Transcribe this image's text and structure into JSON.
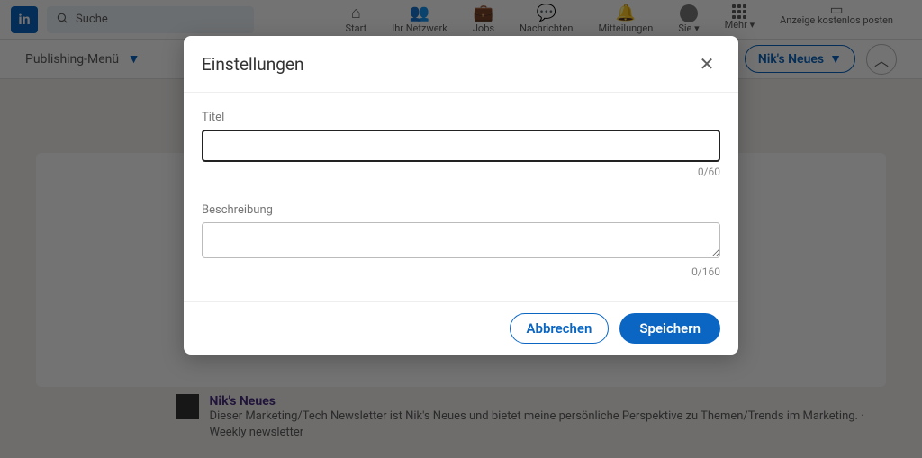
{
  "topnav": {
    "search_placeholder": "Suche",
    "items": [
      {
        "label": "Start"
      },
      {
        "label": "Ihr Netzwerk"
      },
      {
        "label": "Jobs"
      },
      {
        "label": "Nachrichten"
      },
      {
        "label": "Mitteilungen"
      },
      {
        "label": "Sie"
      },
      {
        "label": "Mehr"
      }
    ],
    "post_free": "Anzeige kostenlos posten"
  },
  "secbar": {
    "publishing_menu": "Publishing-Menü",
    "niks_neues": "Nik's Neues"
  },
  "newsletter": {
    "title": "Nik's Neues",
    "desc": "Dieser Marketing/Tech Newsletter ist Nik's Neues und bietet meine persönliche Perspektive zu Themen/Trends im Marketing. · Weekly newsletter"
  },
  "modal": {
    "heading": "Einstellungen",
    "title_label": "Titel",
    "title_value": "",
    "title_counter": "0/60",
    "desc_label": "Beschreibung",
    "desc_value": "",
    "desc_counter": "0/160",
    "cancel": "Abbrechen",
    "save": "Speichern"
  }
}
